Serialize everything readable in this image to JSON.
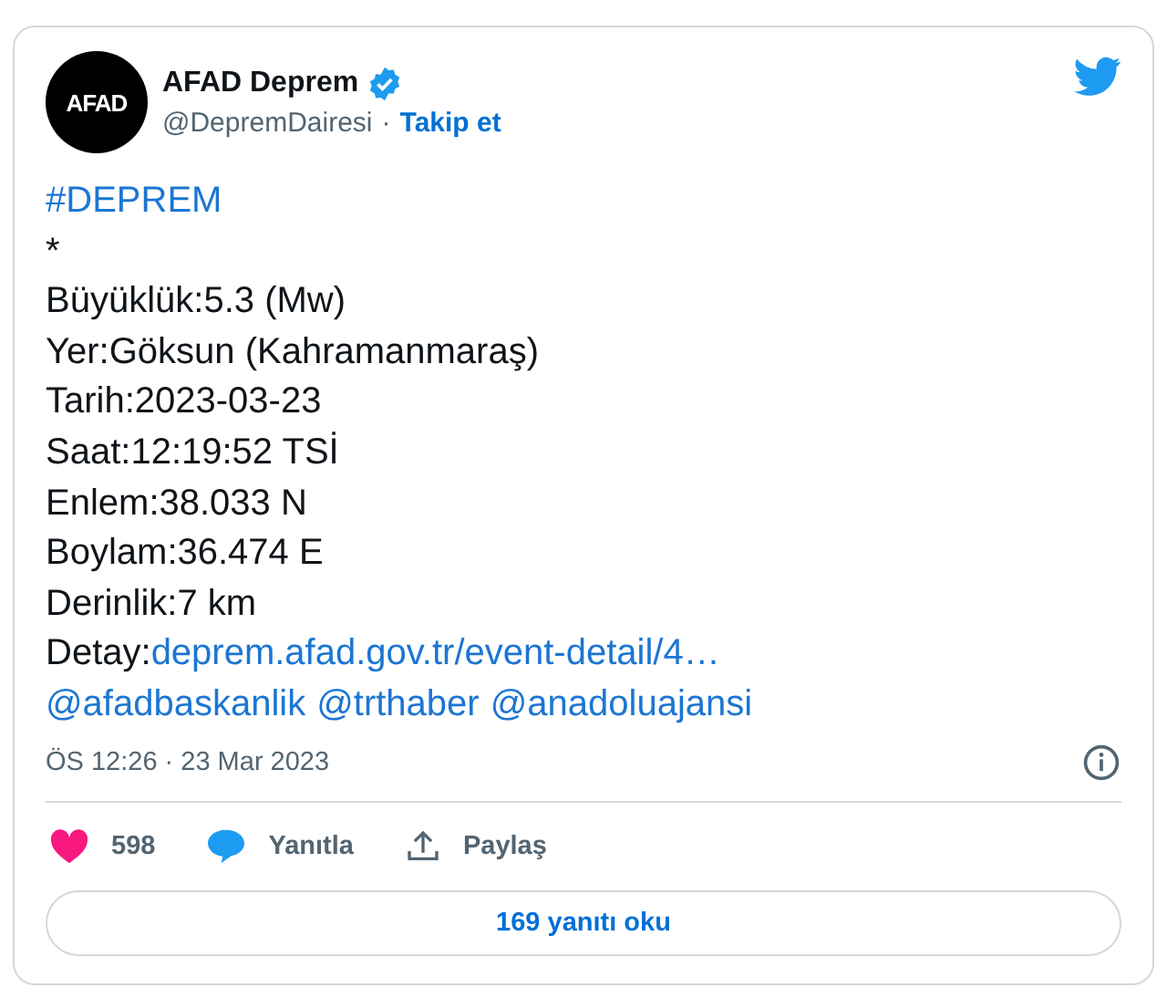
{
  "author": {
    "avatar_text": "AFAD",
    "name": "AFAD Deprem",
    "verified": true,
    "handle": "@DepremDairesi",
    "separator": "·",
    "follow": "Takip et"
  },
  "lines": [
    {
      "parts": [
        {
          "kind": "link",
          "text": "#DEPREM"
        }
      ]
    },
    {
      "parts": [
        {
          "kind": "plain",
          "text": "*"
        }
      ]
    },
    {
      "parts": [
        {
          "kind": "plain",
          "text": "Büyüklük:5.3 (Mw)"
        }
      ]
    },
    {
      "parts": [
        {
          "kind": "plain",
          "text": "Yer:Göksun (Kahramanmaraş)"
        }
      ]
    },
    {
      "parts": [
        {
          "kind": "plain",
          "text": "Tarih:2023-03-23"
        }
      ]
    },
    {
      "parts": [
        {
          "kind": "plain",
          "text": "Saat:12:19:52 TSİ"
        }
      ]
    },
    {
      "parts": [
        {
          "kind": "plain",
          "text": "Enlem:38.033 N"
        }
      ]
    },
    {
      "parts": [
        {
          "kind": "plain",
          "text": "Boylam:36.474 E"
        }
      ]
    },
    {
      "parts": [
        {
          "kind": "plain",
          "text": "Derinlik:7 km"
        }
      ]
    },
    {
      "parts": [
        {
          "kind": "plain",
          "text": "Detay:"
        },
        {
          "kind": "link",
          "text": "deprem.afad.gov.tr/event-detail/4…"
        }
      ]
    }
  ],
  "mentions": [
    "@afadbaskanlik",
    "@trthaber",
    "@anadoluajansi"
  ],
  "timestamp": "ÖS 12:26 · 23 Mar 2023",
  "actions": [
    {
      "kind": "like",
      "label": "598"
    },
    {
      "kind": "reply",
      "label": "Yanıtla"
    },
    {
      "kind": "share",
      "label": "Paylaş"
    }
  ],
  "read_replies": "169 yanıtı oku"
}
